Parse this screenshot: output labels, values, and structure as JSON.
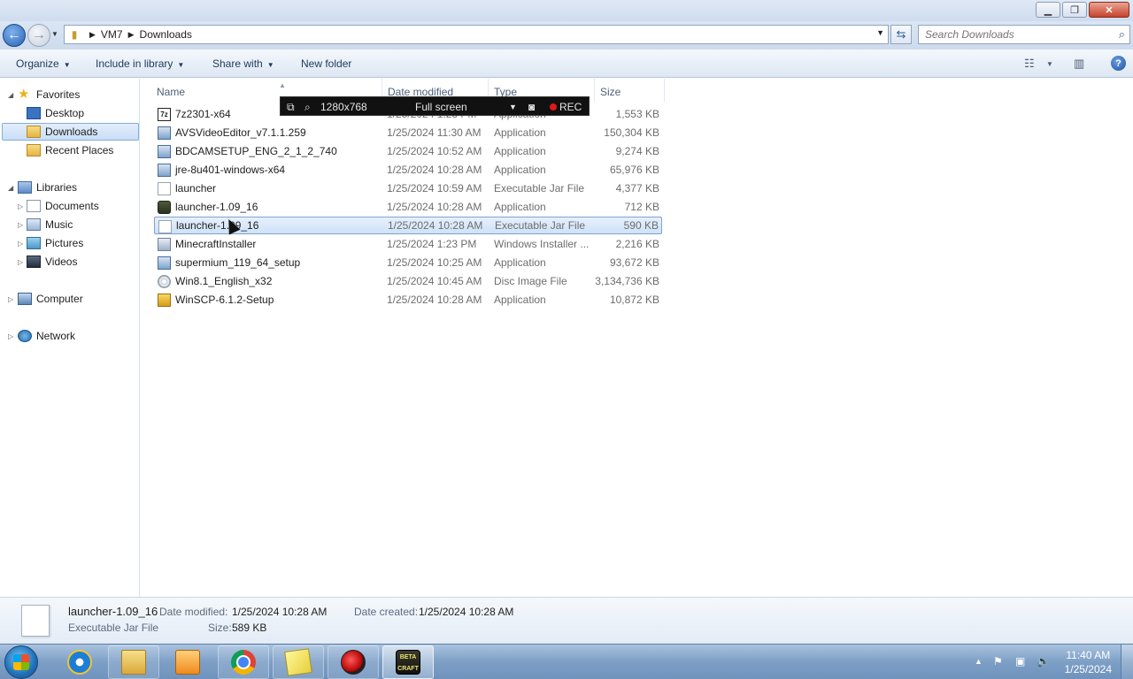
{
  "window": {
    "minimize_glyph": "▁",
    "maximize_glyph": "❐",
    "close_glyph": "✕"
  },
  "address": {
    "crumbs": [
      "VM7",
      "Downloads"
    ],
    "search_placeholder": "Search Downloads"
  },
  "commandbar": {
    "organize": "Organize",
    "include_in_library": "Include in library",
    "share_with": "Share with",
    "new_folder": "New folder"
  },
  "navigation": {
    "favorites": "Favorites",
    "desktop": "Desktop",
    "downloads": "Downloads",
    "recent_places": "Recent Places",
    "libraries": "Libraries",
    "documents": "Documents",
    "music": "Music",
    "pictures": "Pictures",
    "videos": "Videos",
    "computer": "Computer",
    "network": "Network"
  },
  "columns": {
    "name": "Name",
    "date_modified": "Date modified",
    "type": "Type",
    "size": "Size"
  },
  "files": [
    {
      "name": "7z2301-x64",
      "date": "1/25/2024 1:23 PM",
      "type": "Application",
      "size": "1,553 KB",
      "icon": "7zip-icon"
    },
    {
      "name": "AVSVideoEditor_v7.1.1.259",
      "date": "1/25/2024 11:30 AM",
      "type": "Application",
      "size": "150,304 KB",
      "icon": "installer-icon"
    },
    {
      "name": "BDCAMSETUP_ENG_2_1_2_740",
      "date": "1/25/2024 10:52 AM",
      "type": "Application",
      "size": "9,274 KB",
      "icon": "installer-icon"
    },
    {
      "name": "jre-8u401-windows-x64",
      "date": "1/25/2024 10:28 AM",
      "type": "Application",
      "size": "65,976 KB",
      "icon": "java-installer-icon"
    },
    {
      "name": "launcher",
      "date": "1/25/2024 10:59 AM",
      "type": "Executable Jar File",
      "size": "4,377 KB",
      "icon": "jar-file-icon"
    },
    {
      "name": "launcher-1.09_16",
      "date": "1/25/2024 10:28 AM",
      "type": "Application",
      "size": "712 KB",
      "icon": "minecraft-icon"
    },
    {
      "name": "launcher-1.09_16",
      "date": "1/25/2024 10:28 AM",
      "type": "Executable Jar File",
      "size": "590 KB",
      "icon": "jar-file-icon"
    },
    {
      "name": "MinecraftInstaller",
      "date": "1/25/2024 1:23 PM",
      "type": "Windows Installer ...",
      "size": "2,216 KB",
      "icon": "msi-icon"
    },
    {
      "name": "supermium_119_64_setup",
      "date": "1/25/2024 10:25 AM",
      "type": "Application",
      "size": "93,672 KB",
      "icon": "installer-icon"
    },
    {
      "name": "Win8.1_English_x32",
      "date": "1/25/2024 10:45 AM",
      "type": "Disc Image File",
      "size": "3,134,736 KB",
      "icon": "disc-image-icon"
    },
    {
      "name": "WinSCP-6.1.2-Setup",
      "date": "1/25/2024 10:28 AM",
      "type": "Application",
      "size": "10,872 KB",
      "icon": "winscp-icon"
    }
  ],
  "recorder": {
    "resolution": "1280x768",
    "mode": "Full screen",
    "rec_label": "REC"
  },
  "details": {
    "name": "launcher-1.09_16",
    "type": "Executable Jar File",
    "date_modified_label": "Date modified:",
    "date_modified": "1/25/2024 10:28 AM",
    "date_created_label": "Date created:",
    "date_created": "1/25/2024 10:28 AM",
    "size_label": "Size:",
    "size": "589 KB"
  },
  "taskbar": {
    "mc_icon_text": "BETA CRAFT",
    "time": "11:40 AM",
    "date": "1/25/2024"
  },
  "colors": {
    "selection": "#cfe2f8",
    "accent": "#1e395b"
  }
}
